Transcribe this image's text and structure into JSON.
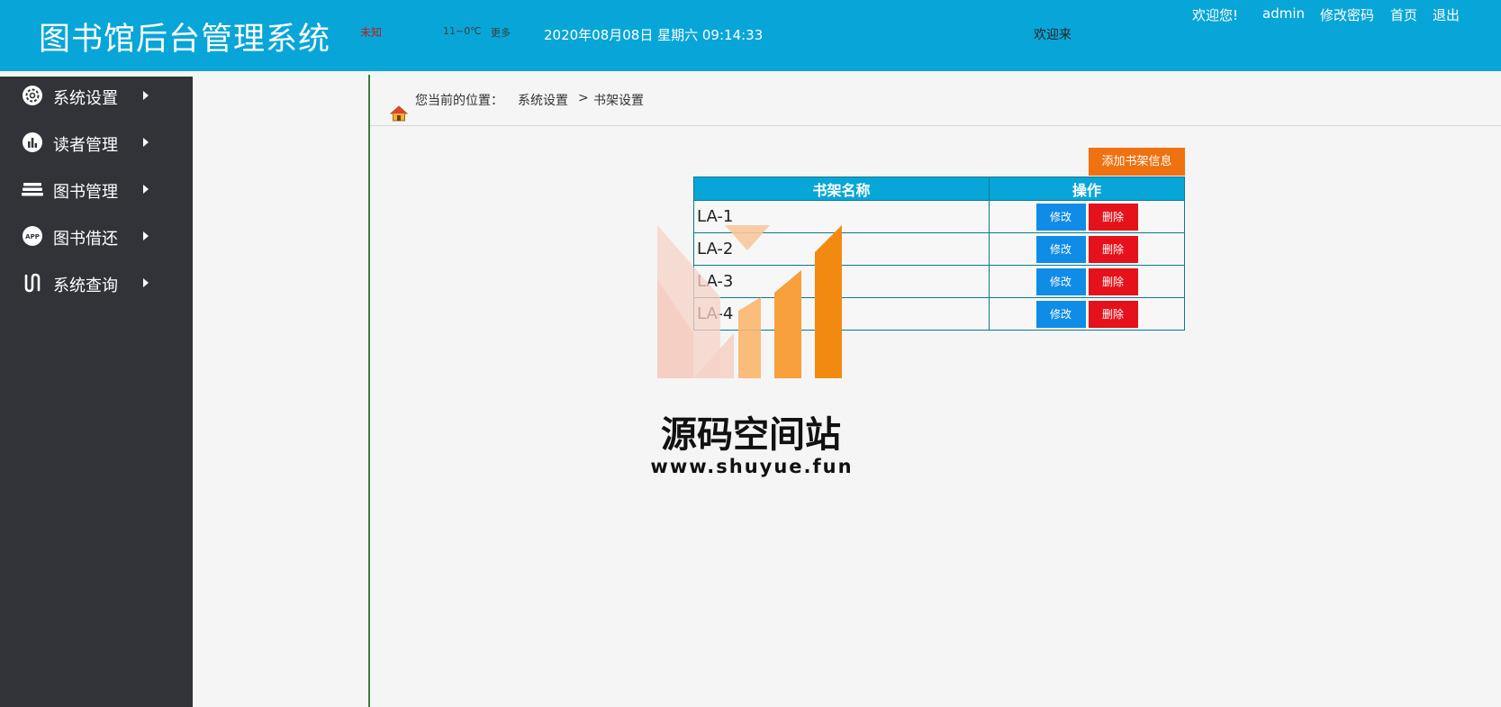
{
  "header": {
    "title": "图书馆后台管理系统",
    "weather_city": "未知",
    "weather_temp": "11~0℃",
    "weather_more": "更多",
    "clock": "2020年08月08日 星期六 09:14:33",
    "welcome_mid": "欢迎来",
    "greeting": "欢迎您!",
    "username": "admin",
    "change_password": "修改密码",
    "home": "首页",
    "logout": "退出"
  },
  "sidebar": {
    "items": [
      {
        "label": "系统设置",
        "icon": "gear-icon"
      },
      {
        "label": "读者管理",
        "icon": "chart-icon"
      },
      {
        "label": "图书管理",
        "icon": "stack-icon"
      },
      {
        "label": "图书借还",
        "icon": "app-icon"
      },
      {
        "label": "系统查询",
        "icon": "query-icon"
      }
    ]
  },
  "breadcrumb": {
    "label": "您当前的位置：",
    "level1": "系统设置",
    "separator": ">",
    "level2": "书架设置"
  },
  "toolbar": {
    "add_label": "添加书架信息"
  },
  "table": {
    "headers": [
      "书架名称",
      "操作"
    ],
    "rows": [
      {
        "name": "LA-1",
        "edit": "修改",
        "delete": "删除"
      },
      {
        "name": "LA-2",
        "edit": "修改",
        "delete": "删除"
      },
      {
        "name": "LA-3",
        "edit": "修改",
        "delete": "删除"
      },
      {
        "name": "LA-4",
        "edit": "修改",
        "delete": "删除"
      }
    ]
  },
  "watermark": {
    "title": "源码空间站",
    "url": "www.shuyue.fun"
  },
  "colors": {
    "header_bg": "#08a6d8",
    "sidebar_bg": "#313339",
    "add_button": "#f0710f",
    "edit_button": "#0f8ce6",
    "delete_button": "#e5121b"
  }
}
